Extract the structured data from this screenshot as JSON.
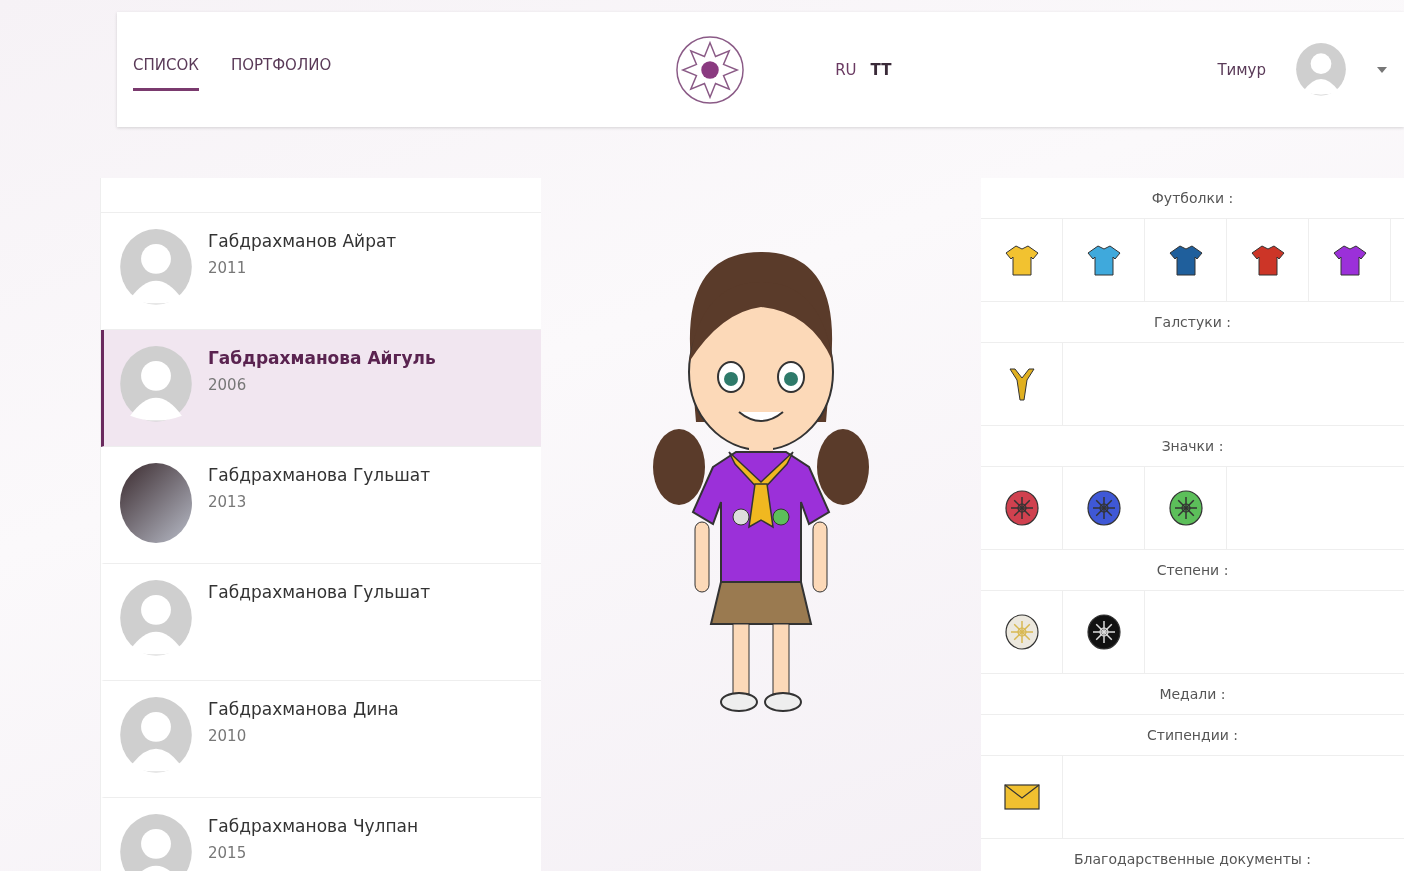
{
  "nav": {
    "tabs": [
      {
        "label": "СПИСОК",
        "selected": true
      },
      {
        "label": "ПОРТФОЛИО",
        "selected": false
      }
    ],
    "languages": [
      {
        "label": "RU",
        "selected": false
      },
      {
        "label": "TT",
        "selected": true
      }
    ],
    "user": {
      "name": "Тимур"
    }
  },
  "people": [
    {
      "name": "Габдрахманов Айрат",
      "year": "2011",
      "kind": "default",
      "selected": false
    },
    {
      "name": "Габдрахманова Айгуль",
      "year": "2006",
      "kind": "default",
      "selected": true
    },
    {
      "name": "Габдрахманова Гульшат",
      "year": "2013",
      "kind": "photo",
      "selected": false
    },
    {
      "name": "Габдрахманова Гульшат",
      "kind": "default",
      "selected": false
    },
    {
      "name": "Габдрахманова Дина",
      "year": "2010",
      "kind": "default",
      "selected": false
    },
    {
      "name": "Габдрахманова Чулпан",
      "year": "2015",
      "kind": "default",
      "selected": false
    }
  ],
  "sections": [
    {
      "title": "Футболки :",
      "items": [
        {
          "kind": "shirt",
          "color": "#f2c230"
        },
        {
          "kind": "shirt",
          "color": "#3fa9dc"
        },
        {
          "kind": "shirt",
          "color": "#1f5f9c"
        },
        {
          "kind": "shirt",
          "color": "#cc3527"
        },
        {
          "kind": "shirt",
          "color": "#9b30d9"
        }
      ]
    },
    {
      "title": "Галстуки :",
      "items": [
        {
          "kind": "tie"
        }
      ]
    },
    {
      "title": "Значки :",
      "items": [
        {
          "kind": "badge",
          "color": "#d0414f"
        },
        {
          "kind": "badge",
          "color": "#3f58d6"
        },
        {
          "kind": "badge",
          "color": "#5cbf5a"
        }
      ]
    },
    {
      "title": "Степени :",
      "items": [
        {
          "kind": "degree",
          "color": "#ece8de"
        },
        {
          "kind": "degree",
          "color": "#111111"
        }
      ]
    },
    {
      "title": "Медали :"
    },
    {
      "title": "Стипендии :",
      "items": [
        {
          "kind": "envelope"
        }
      ]
    },
    {
      "title": "Благодарственные документы :"
    }
  ]
}
